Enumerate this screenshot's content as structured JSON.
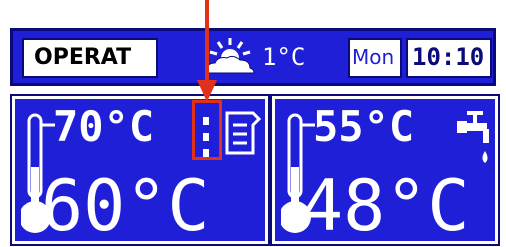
{
  "status_bar": {
    "mode": "OPERAT",
    "outdoor_temperature": "1°C",
    "day": "Mon",
    "time": "10:10",
    "weather_icon": "sun-cloud-icon"
  },
  "boiler_panel": {
    "preset_temperature": "70°C",
    "actual_temperature": "60°C",
    "icon": "boiler-icon"
  },
  "dhw_panel": {
    "preset_temperature": "55°C",
    "actual_temperature": "48°C",
    "icon": "tap-icon"
  },
  "colors": {
    "screen_blue": "#1f1fd8",
    "dark_blue": "#0a0a7a",
    "white": "#ffffff",
    "highlight_red": "#e0321a"
  }
}
